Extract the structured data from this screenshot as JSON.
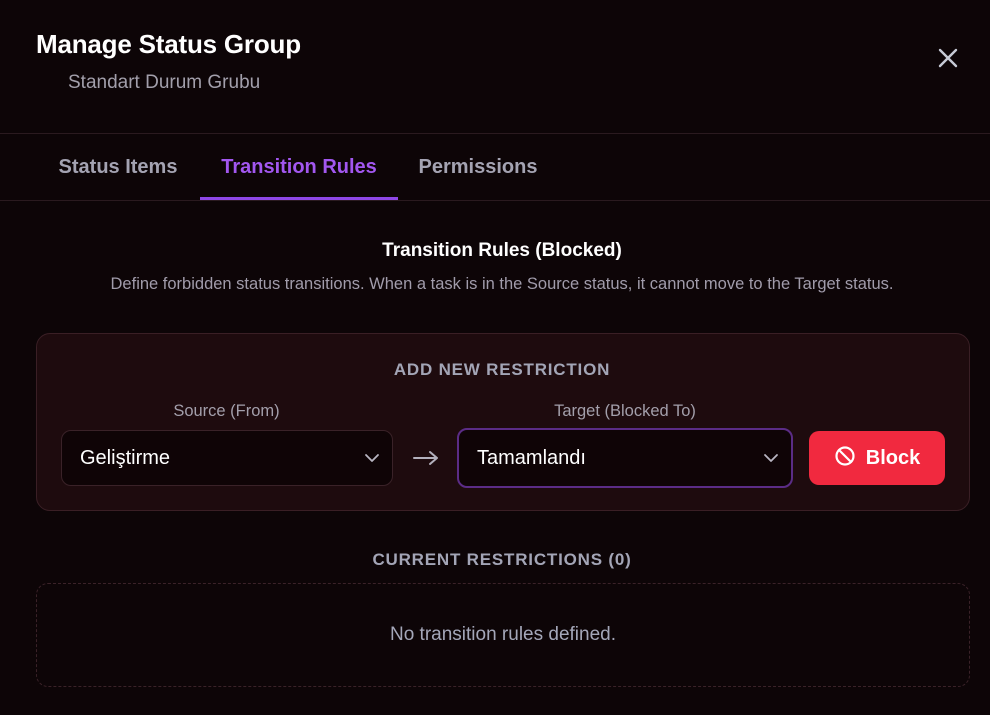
{
  "header": {
    "title": "Manage Status Group",
    "subtitle": "Standart Durum Grubu",
    "close_icon": "close-icon"
  },
  "tabs": [
    {
      "label": "Status Items",
      "active": false
    },
    {
      "label": "Transition Rules",
      "active": true
    },
    {
      "label": "Permissions",
      "active": false
    }
  ],
  "section": {
    "title": "Transition Rules (Blocked)",
    "description": "Define forbidden status transitions. When a task is in the Source status, it cannot move to the Target status."
  },
  "add_restriction": {
    "title": "ADD NEW RESTRICTION",
    "source_label": "Source (From)",
    "source_value": "Geliştirme",
    "target_label": "Target (Blocked To)",
    "target_value": "Tamamlandı",
    "arrow_icon": "arrow-right-icon",
    "block_label": "Block",
    "block_icon": "ban-icon"
  },
  "current_restrictions": {
    "title": "CURRENT RESTRICTIONS (0)",
    "empty_text": "No transition rules defined."
  },
  "colors": {
    "background": "#0d0507",
    "accent": "#a257f0",
    "danger": "#f1293f",
    "card": "#1e0b0e"
  }
}
